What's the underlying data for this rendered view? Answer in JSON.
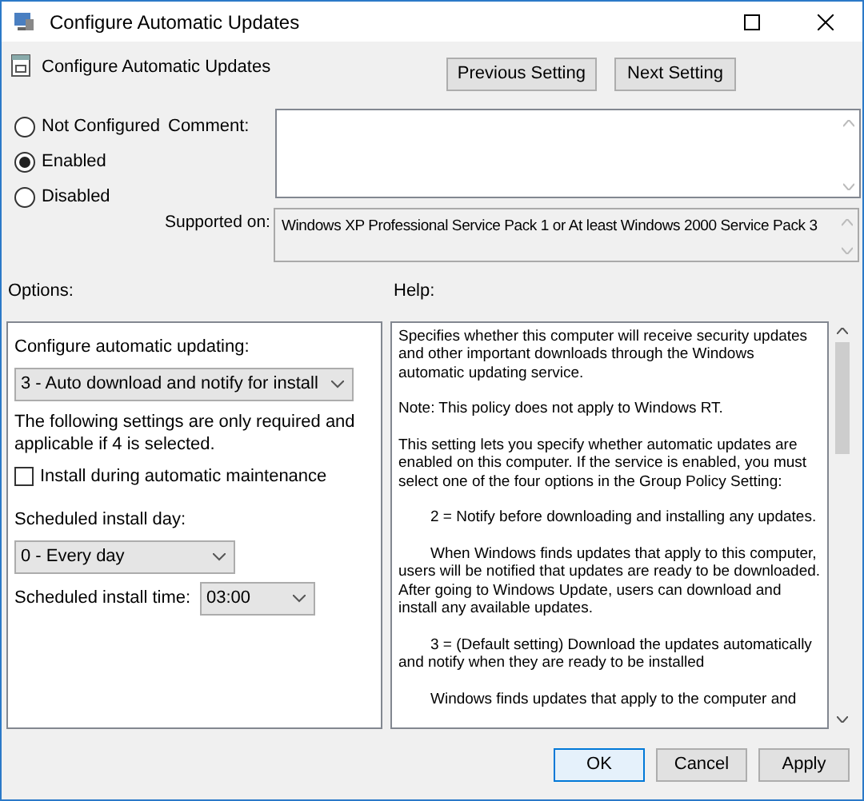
{
  "window": {
    "title": "Configure Automatic Updates"
  },
  "header": {
    "title": "Configure Automatic Updates",
    "buttons": [
      "Previous Setting",
      "Next Setting"
    ]
  },
  "state_options": [
    {
      "label": "Not Configured",
      "selected": false
    },
    {
      "label": "Enabled",
      "selected": true
    },
    {
      "label": "Disabled",
      "selected": false
    }
  ],
  "comment": {
    "label": "Comment:"
  },
  "supported_on": {
    "label": "Supported on:",
    "value": "Windows XP Professional Service Pack 1 or At least Windows 2000 Service Pack 3"
  },
  "options": {
    "label": "Options:",
    "items": [
      {
        "kind": "label",
        "text": "Configure automatic updating:"
      },
      {
        "kind": "dropdown",
        "value": "3 - Auto download and notify for install",
        "wide": true
      },
      {
        "kind": "note",
        "text": "The following settings are only required and applicable if 4 is selected."
      },
      {
        "kind": "checkbox",
        "text": "Install during automatic maintenance",
        "checked": false
      },
      {
        "kind": "label",
        "text": "Scheduled install day:"
      },
      {
        "kind": "dropdown",
        "value": "0 - Every day",
        "wide": false
      },
      {
        "kind": "labeled_dropdown",
        "text": "Scheduled install time:",
        "value": "03:00"
      }
    ]
  },
  "help": {
    "label": "Help:",
    "paragraphs": [
      {
        "kind": "plain",
        "text": "Specifies whether this computer will receive security updates and other important downloads through the Windows automatic updating service."
      },
      {
        "kind": "plain",
        "text": "Note: This policy does not apply to Windows RT."
      },
      {
        "kind": "plain",
        "text": "This setting lets you specify whether automatic updates are enabled on this computer. If the service is enabled, you must select one of the four options in the Group Policy Setting:"
      },
      {
        "kind": "indented",
        "text": "2 = Notify before downloading and installing any updates."
      },
      {
        "kind": "indented",
        "text": "When Windows finds updates that apply to this computer, users will be notified that updates are ready to be downloaded. After going to Windows Update, users can download and install any available updates."
      },
      {
        "kind": "indented",
        "text": "3 = (Default setting) Download the updates automatically and notify when they are ready to be installed"
      },
      {
        "kind": "indented",
        "text": "Windows finds updates that apply to the computer and"
      }
    ]
  },
  "footer_buttons": [
    {
      "label": "OK",
      "default": true
    },
    {
      "label": "Cancel",
      "default": false
    },
    {
      "label": "Apply",
      "default": false
    }
  ]
}
